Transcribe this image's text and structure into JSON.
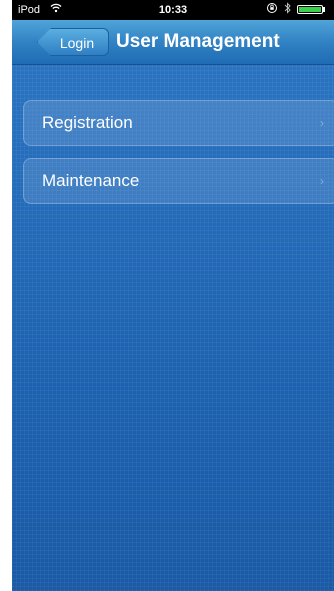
{
  "status_bar": {
    "carrier": "iPod",
    "wifi_icon": "wifi-icon",
    "time": "10:33",
    "lock_icon": "orientation-lock-icon",
    "bluetooth_icon": "bluetooth-icon",
    "battery_icon": "battery-icon",
    "battery_level": 1.0
  },
  "nav": {
    "back_label": "Login",
    "title": "User Management"
  },
  "menu": {
    "items": [
      {
        "label": "Registration",
        "icon": "chevron-right-icon"
      },
      {
        "label": "Maintenance",
        "icon": "chevron-right-icon"
      }
    ]
  },
  "colors": {
    "nav_bar": "#3a8fcf",
    "background": "#1f5fae",
    "battery": "#39d24a"
  }
}
